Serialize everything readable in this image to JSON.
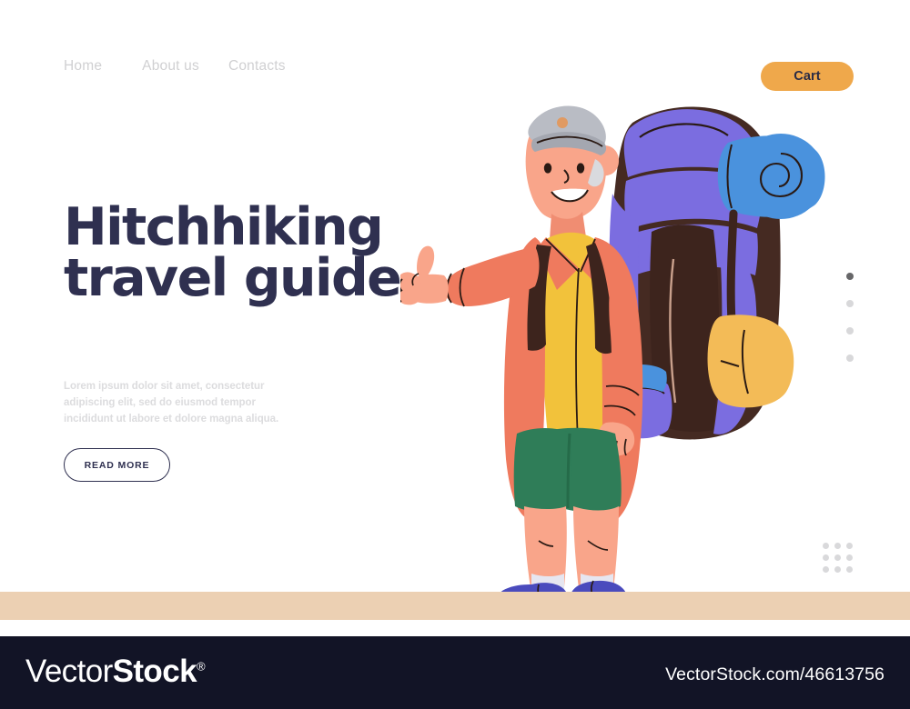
{
  "nav": {
    "links": [
      {
        "label": "Home",
        "name": "nav-link-home"
      },
      {
        "label": "About us",
        "name": "nav-link-about-us"
      },
      {
        "label": "Contacts",
        "name": "nav-link-contacts"
      }
    ],
    "cart_label": "Cart"
  },
  "hero": {
    "title_line1": "Hitchhiking",
    "title_line2": "travel guide",
    "paragraph": "Lorem ipsum dolor sit amet, consectetur adipiscing elit, sed do eiusmod tempor incididunt ut labore et dolore magna aliqua.",
    "cta_label": "READ MORE"
  },
  "slider": {
    "dots": [
      {
        "active": true
      },
      {
        "active": false
      },
      {
        "active": false
      },
      {
        "active": false
      }
    ]
  },
  "decor": {
    "grid_dots_count": 9
  },
  "illustration": {
    "name": "hitchhiker-with-backpack-illustration",
    "description": "Smiling traveler in cap giving thumbs up, wearing coral jacket, yellow shirt, green shorts and blue shoes with a large purple hiking backpack",
    "colors": {
      "skin": "#f9a58a",
      "skin_shadow": "#f08d72",
      "jacket": "#ef7a5e",
      "jacket_shade": "#e2664b",
      "shirt": "#f2c23b",
      "shorts": "#2f7d58",
      "shorts_shade": "#256b49",
      "shoes": "#4a4bbd",
      "shoes_shade": "#3b3caa",
      "socks": "#e6e6f0",
      "cap": "#b9bcc4",
      "cap_shade": "#a4a7b0",
      "backpack_purple": "#7b6de0",
      "backpack_brown": "#452a22",
      "mat_blue": "#4a92dd",
      "pouch_yellow": "#f3bb57",
      "bottle_blue": "#4a92dd",
      "outline": "#2a1a14"
    }
  },
  "ground": {
    "color": "#ecd0b3"
  },
  "footer": {
    "logo_light": "Vector",
    "logo_bold": "Stock",
    "logo_registered": "®",
    "url": "VectorStock.com/46613756",
    "background": "#121426"
  },
  "theme": {
    "accent_orange": "#efa84b",
    "dark_navy": "#2f3050",
    "nav_gray": "#d0d0d2",
    "body_gray": "#dcdcde",
    "white": "#ffffff"
  }
}
